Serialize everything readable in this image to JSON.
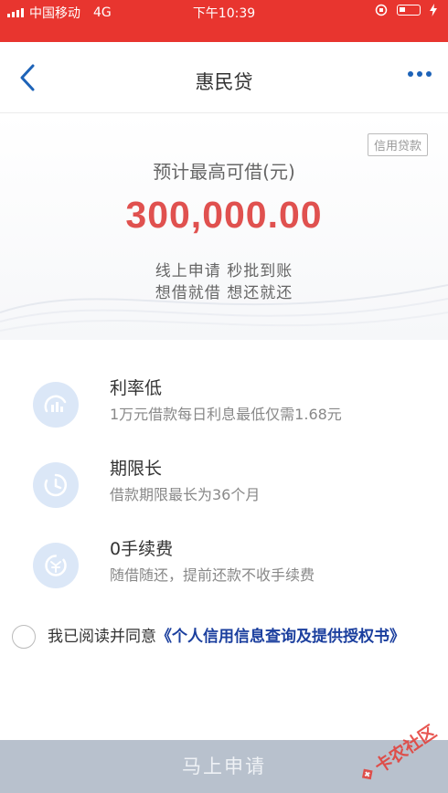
{
  "status_bar": {
    "carrier": "中国移动",
    "network": "4G",
    "time": "下午10:39"
  },
  "nav": {
    "title": "惠民贷"
  },
  "hero": {
    "tag": "信用贷款",
    "label": "预计最高可借(元)",
    "amount": "300,000.00",
    "line1": "线上申请  秒批到账",
    "line2": "想借就借  想还就还"
  },
  "features": [
    {
      "title": "利率低",
      "desc": "1万元借款每日利息最低仅需1.68元",
      "icon": "rate-chart-icon"
    },
    {
      "title": "期限长",
      "desc": "借款期限最长为36个月",
      "icon": "clock-icon"
    },
    {
      "title": "0手续费",
      "desc": "随借随还，提前还款不收手续费",
      "icon": "coin-icon"
    }
  ],
  "agreement": {
    "prefix": "我已阅读并同意",
    "link": "《个人信用信息查询及提供授权书》"
  },
  "apply_button": "马上申请",
  "watermark": "卡农社区",
  "colors": {
    "status_bar": "#e8352f",
    "amount": "#e0514f",
    "link": "#1b3f9e",
    "button": "#b8c1cd",
    "icon_bg": "#dbe7f7"
  }
}
